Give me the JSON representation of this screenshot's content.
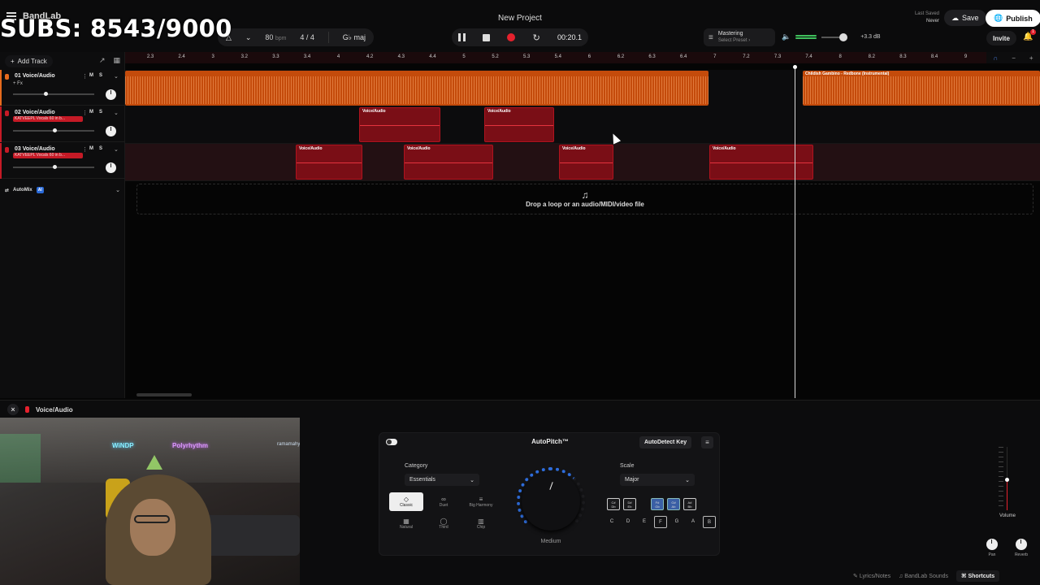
{
  "overlay": {
    "subs": "SUBS: 8543/9000"
  },
  "app": {
    "logo": "BandLab",
    "title": "New Project"
  },
  "transport": {
    "tempo": "80",
    "tempo_unit": "bpm",
    "time_signature": "4 / 4",
    "key": "G♭ maj",
    "time": "00:20.1"
  },
  "mastering": {
    "label": "Mastering",
    "preset": "Select Preset ›"
  },
  "volume": {
    "db": "+3.3 dB"
  },
  "save_status": {
    "label": "Last Saved",
    "value": "Never"
  },
  "buttons": {
    "save": "Save",
    "publish": "Publish",
    "invite": "Invite",
    "add_track": "Add Track",
    "notification_count": "1"
  },
  "ruler": [
    "2.3",
    "2.4",
    "3",
    "3.2",
    "3.3",
    "3.4",
    "4",
    "4.2",
    "4.3",
    "4.4",
    "5",
    "5.2",
    "5.3",
    "5.4",
    "6",
    "6.2",
    "6.3",
    "6.4",
    "7",
    "7.2",
    "7.3",
    "7.4",
    "8",
    "8.2",
    "8.3",
    "8.4",
    "9"
  ],
  "tracks": [
    {
      "name": "01  Voice/Audio",
      "sub": "+ Fx",
      "plugin": "",
      "color": "#e56a1d",
      "fader": 0.4
    },
    {
      "name": "02  Voice/Audio",
      "sub": "",
      "plugin": "KATVEEPL Vocals 60 in b...",
      "color": "#c51a26",
      "fader": 0.5
    },
    {
      "name": "03  Voice/Audio",
      "sub": "",
      "plugin": "KATVEEPL Vocals 60 in b...",
      "color": "#c51a26",
      "fader": 0.5
    }
  ],
  "regions": {
    "track1": [
      {
        "label": ""
      },
      {
        "label": "Childish Gambino - Redbone (Instrumental)"
      }
    ],
    "track2": [
      {
        "label": "Voice/Audio"
      },
      {
        "label": "Voice/Audio"
      }
    ],
    "track3": [
      {
        "label": "Voice/Audio"
      },
      {
        "label": "Voice/Audio"
      },
      {
        "label": "Voice/Audio"
      },
      {
        "label": "Voice/Audio"
      }
    ]
  },
  "automix": {
    "label": "AutoMix",
    "badge": "AI"
  },
  "dropzone": {
    "text": "Drop a loop or an audio/MIDI/video file"
  },
  "panel": {
    "title": "Voice/Audio"
  },
  "webcam": {
    "sign1": "WiNDP",
    "sign2": "Polyrhythm",
    "sign3": "ramamahy"
  },
  "autopitch": {
    "title": "AutoPitch™",
    "autodetect": "AutoDetect Key",
    "category_label": "Category",
    "category_value": "Essentials",
    "categories": [
      "Classic",
      "Duet",
      "Big Harmony",
      "Natural",
      "Third",
      "Chip"
    ],
    "knob_label": "Medium",
    "scale_label": "Scale",
    "scale_value": "Major",
    "key_chips": [
      "C#\nDb",
      "D#\nEb",
      "F#\nGb",
      "G#\nAb",
      "A#\nBb"
    ],
    "notes": [
      "C",
      "D",
      "E",
      "F",
      "G",
      "A",
      "B"
    ]
  },
  "mixer": {
    "volume": "Volume",
    "pan": "Pan",
    "reverb": "Reverb"
  },
  "footer": {
    "lyrics": "Lyrics/Notes",
    "sounds": "BandLab Sounds",
    "shortcuts": "Shortcuts"
  }
}
